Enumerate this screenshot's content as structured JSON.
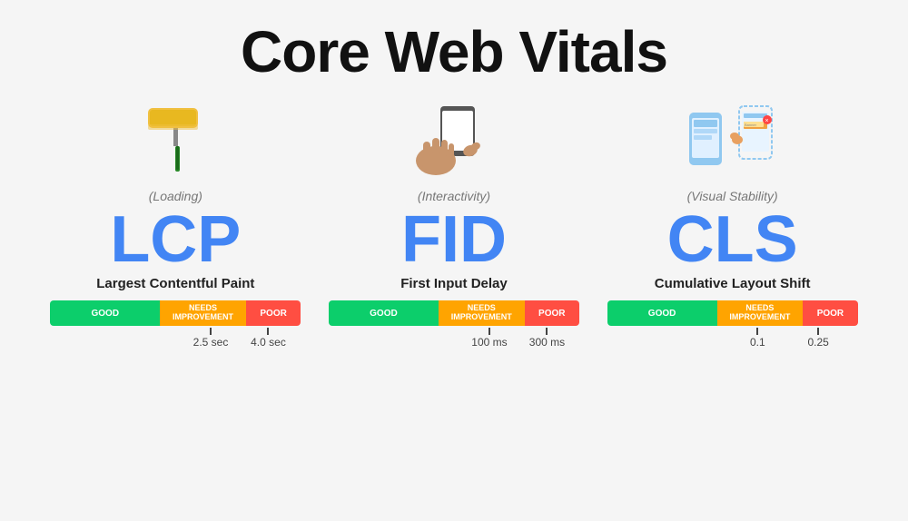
{
  "page": {
    "title": "Core Web Vitals",
    "background": "#f5f5f5"
  },
  "vitals": [
    {
      "id": "lcp",
      "acronym": "LCP",
      "full_name": "Largest Contentful Paint",
      "subtitle": "(Loading)",
      "icon": "🖌️",
      "bar": {
        "good_label": "GOOD",
        "needs_label": "NEEDS\nIMPROVEMENT",
        "poor_label": "POOR"
      },
      "markers": [
        {
          "value": "2.5 sec",
          "position_pct": 57
        },
        {
          "value": "4.0 sec",
          "position_pct": 80
        }
      ]
    },
    {
      "id": "fid",
      "acronym": "FID",
      "full_name": "First Input Delay",
      "subtitle": "(Interactivity)",
      "icon": "📱",
      "bar": {
        "good_label": "GOOD",
        "needs_label": "NEEDS\nIMPROVEMENT",
        "poor_label": "POOR"
      },
      "markers": [
        {
          "value": "100 ms",
          "position_pct": 57
        },
        {
          "value": "300 ms",
          "position_pct": 80
        }
      ]
    },
    {
      "id": "cls",
      "acronym": "CLS",
      "full_name": "Cumulative Layout Shift",
      "subtitle": "(Visual Stability)",
      "icon": "📲",
      "bar": {
        "good_label": "GOOD",
        "needs_label": "NEEDS\nIMPROVEMENT",
        "poor_label": "POOR"
      },
      "markers": [
        {
          "value": "0.1",
          "position_pct": 57
        },
        {
          "value": "0.25",
          "position_pct": 80
        }
      ]
    }
  ]
}
